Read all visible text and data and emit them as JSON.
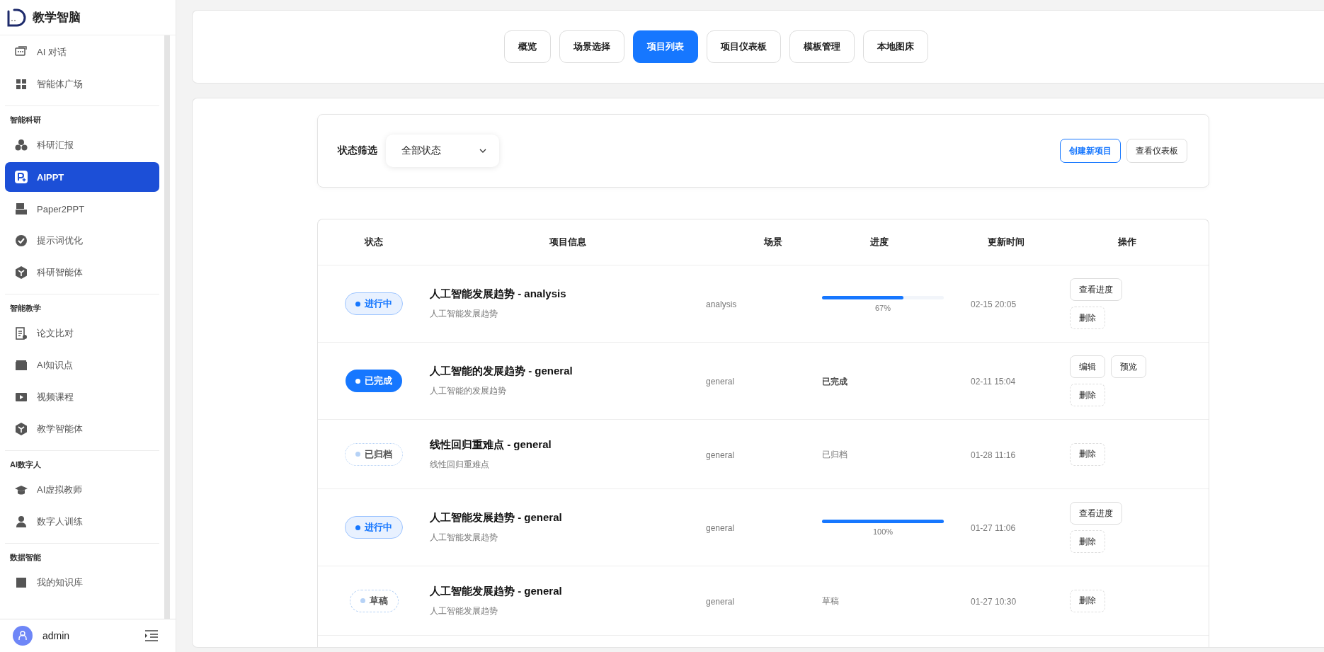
{
  "app": {
    "title": "教学智脑"
  },
  "sidebar": {
    "groups": [
      {
        "items": [
          {
            "label": "AI 对话",
            "selected": false
          },
          {
            "label": "智能体广场",
            "selected": false
          }
        ]
      },
      {
        "title": "智能科研",
        "items": [
          {
            "label": "科研汇报",
            "selected": false
          },
          {
            "label": "AIPPT",
            "selected": true
          },
          {
            "label": "Paper2PPT",
            "selected": false
          },
          {
            "label": "提示词优化",
            "selected": false
          },
          {
            "label": "科研智能体",
            "selected": false
          }
        ]
      },
      {
        "title": "智能教学",
        "items": [
          {
            "label": "论文比对",
            "selected": false
          },
          {
            "label": "AI知识点",
            "selected": false
          },
          {
            "label": "视频课程",
            "selected": false
          },
          {
            "label": "教学智能体",
            "selected": false
          }
        ]
      },
      {
        "title": "AI数字人",
        "items": [
          {
            "label": "AI虚拟教师",
            "selected": false
          },
          {
            "label": "数字人训练",
            "selected": false
          }
        ]
      },
      {
        "title": "数据智能",
        "items": [
          {
            "label": "我的知识库",
            "selected": false
          }
        ]
      }
    ],
    "user": "admin"
  },
  "tabs": [
    {
      "label": "概览",
      "selected": false
    },
    {
      "label": "场景选择",
      "selected": false
    },
    {
      "label": "项目列表",
      "selected": true
    },
    {
      "label": "项目仪表板",
      "selected": false
    },
    {
      "label": "模板管理",
      "selected": false
    },
    {
      "label": "本地图床",
      "selected": false
    }
  ],
  "filter": {
    "label": "状态筛选",
    "value": "全部状态",
    "buttons": [
      {
        "label": "创建新项目",
        "kind": "primary"
      },
      {
        "label": "查看仪表板",
        "kind": "default"
      }
    ]
  },
  "table": {
    "columns": [
      "状态",
      "项目信息",
      "场景",
      "进度",
      "更新时间",
      "操作"
    ],
    "rows": [
      {
        "status": {
          "label": "进行中",
          "kind": "active"
        },
        "title": "人工智能发展趋势 - analysis",
        "subtitle": "人工智能发展趋势",
        "scene": "analysis",
        "progress": {
          "kind": "bar",
          "level": 0.67,
          "reading": "67%"
        },
        "updated": "02-15 20:05",
        "actions": [
          {
            "label": "查看进度",
            "kind": "solid"
          },
          {
            "label": "删除",
            "kind": "dashed"
          }
        ]
      },
      {
        "status": {
          "label": "已完成",
          "kind": "done"
        },
        "title": "人工智能的发展趋势 - general",
        "subtitle": "人工智能的发展趋势",
        "scene": "general",
        "progress": {
          "kind": "text",
          "text": "已完成",
          "bold": true
        },
        "updated": "02-11 15:04",
        "actions": [
          {
            "label": "编辑",
            "kind": "solid"
          },
          {
            "label": "预览",
            "kind": "solid"
          },
          {
            "label": "删除",
            "kind": "dashed"
          }
        ]
      },
      {
        "status": {
          "label": "已归档",
          "kind": "archived"
        },
        "title": "线性回归重难点 - general",
        "subtitle": "线性回归重难点",
        "scene": "general",
        "progress": {
          "kind": "text",
          "text": "已归档",
          "bold": false
        },
        "updated": "01-28 11:16",
        "actions": [
          {
            "label": "删除",
            "kind": "dashed"
          }
        ]
      },
      {
        "status": {
          "label": "进行中",
          "kind": "active"
        },
        "title": "人工智能发展趋势 - general",
        "subtitle": "人工智能发展趋势",
        "scene": "general",
        "progress": {
          "kind": "bar",
          "level": 1,
          "reading": "100%"
        },
        "updated": "01-27 11:06",
        "actions": [
          {
            "label": "查看进度",
            "kind": "solid"
          },
          {
            "label": "删除",
            "kind": "dashed"
          }
        ]
      },
      {
        "status": {
          "label": "草稿",
          "kind": "draft"
        },
        "title": "人工智能发展趋势 - general",
        "subtitle": "人工智能发展趋势",
        "scene": "general",
        "progress": {
          "kind": "text",
          "text": "草稿",
          "bold": false
        },
        "updated": "01-27 10:30",
        "actions": [
          {
            "label": "删除",
            "kind": "dashed"
          }
        ]
      }
    ]
  }
}
